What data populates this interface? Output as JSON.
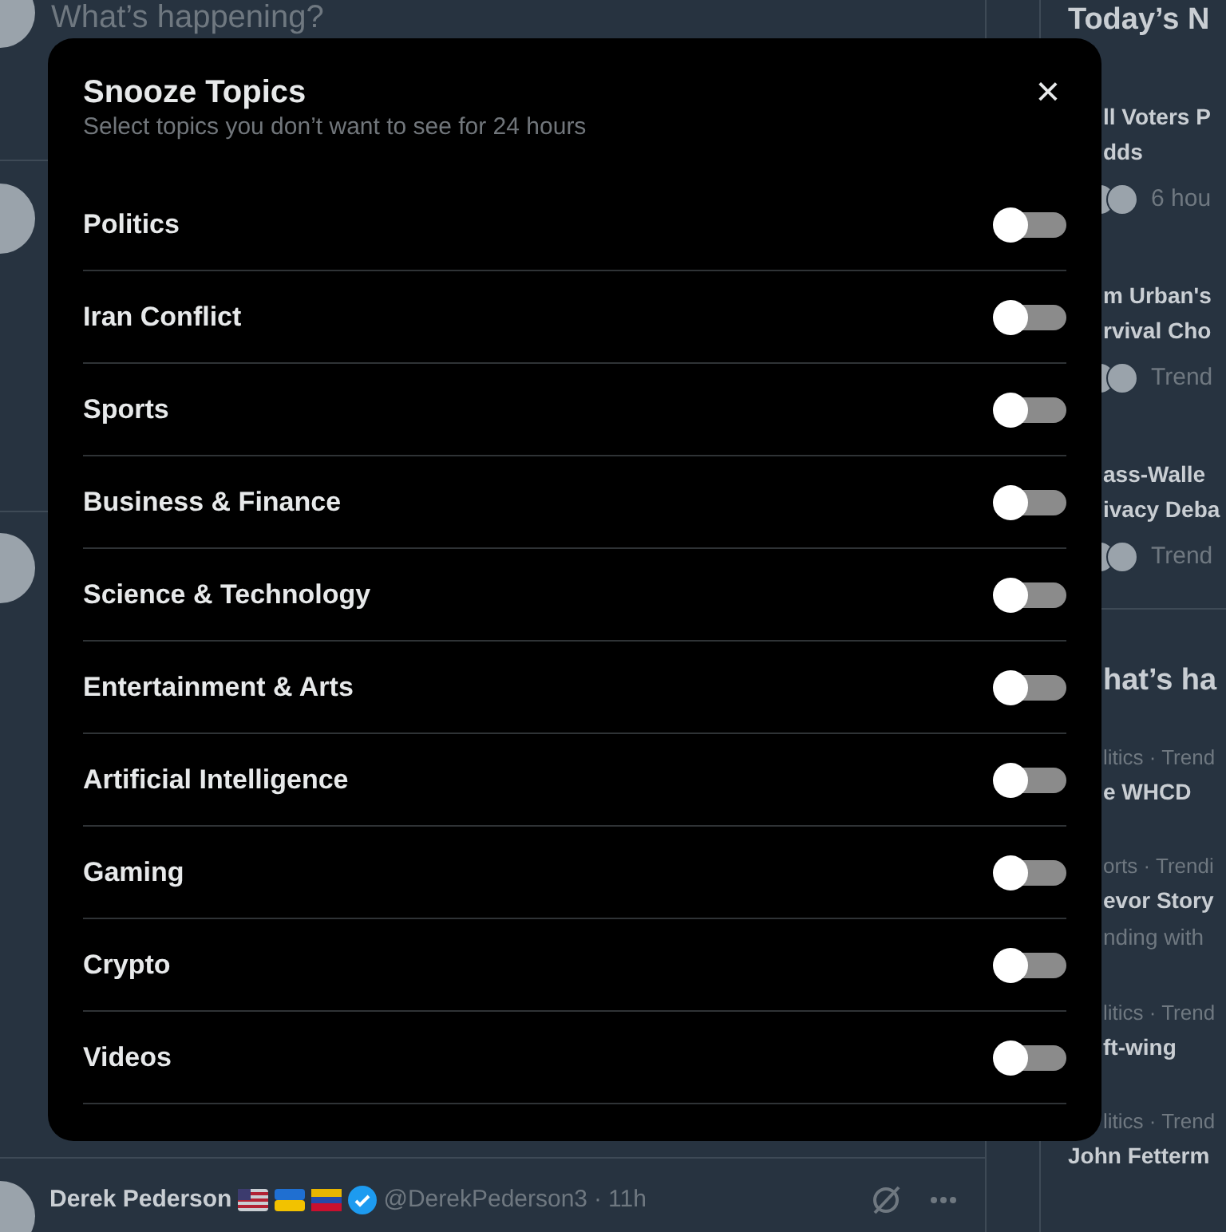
{
  "timeline": {
    "composer": {
      "placeholder": "What’s happening?"
    },
    "post": {
      "author": "Derek Pederson",
      "handle": "@DerekPederson3",
      "separator": "·",
      "time": "11h"
    }
  },
  "sidebar": {
    "news_title": "Today’s N",
    "news": [
      {
        "headline": [
          "ll Voters P",
          "dds"
        ],
        "meta": "6 hou"
      },
      {
        "headline": [
          "m Urban's",
          "rvival Cho"
        ],
        "meta": "Trend"
      },
      {
        "headline": [
          "ass-Walle",
          "ivacy Deba"
        ],
        "meta": "Trend"
      }
    ],
    "trends_title": "hat’s ha",
    "trends": [
      {
        "context": "litics · Trend",
        "topic": "e WHCD"
      },
      {
        "context": "orts · Trendi",
        "topic": "evor Story",
        "extra": "nding with"
      },
      {
        "context": "litics · Trend",
        "topic": "ft-wing"
      },
      {
        "context": "litics · Trend",
        "topic": "John Fetterm"
      }
    ]
  },
  "modal": {
    "title": "Snooze Topics",
    "subtitle": "Select topics you don’t want to see for 24 hours",
    "close": "×",
    "topics": [
      {
        "label": "Politics",
        "checked": false
      },
      {
        "label": "Iran Conflict",
        "checked": false
      },
      {
        "label": "Sports",
        "checked": false
      },
      {
        "label": "Business & Finance",
        "checked": false
      },
      {
        "label": "Science & Technology",
        "checked": false
      },
      {
        "label": "Entertainment & Arts",
        "checked": false
      },
      {
        "label": "Artificial Intelligence",
        "checked": false
      },
      {
        "label": "Gaming",
        "checked": false
      },
      {
        "label": "Crypto",
        "checked": false
      },
      {
        "label": "Videos",
        "checked": false
      }
    ]
  }
}
